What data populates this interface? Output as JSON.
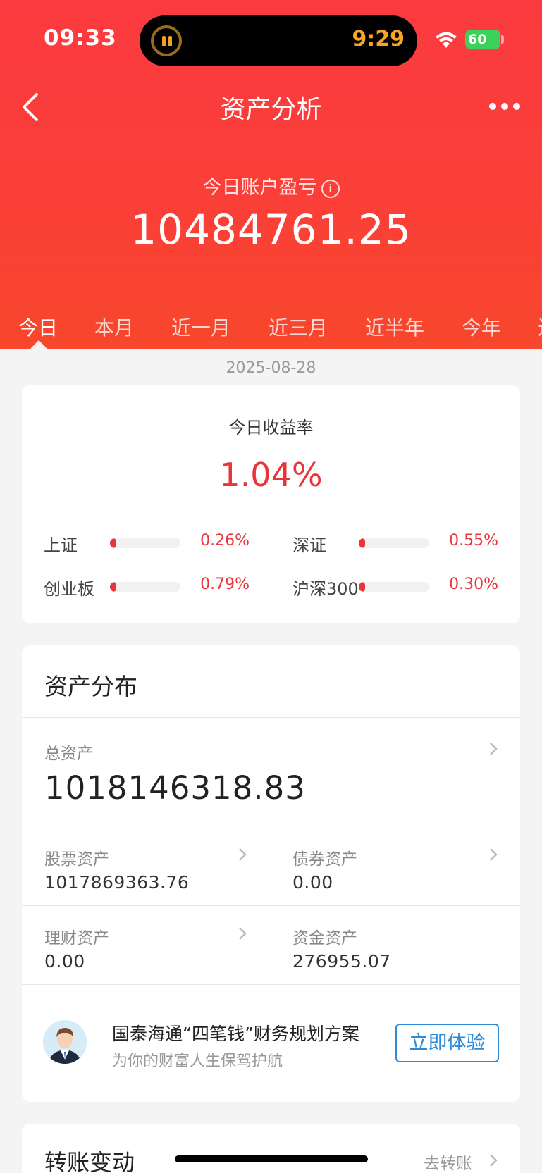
{
  "status_bar": {
    "time": "09:33",
    "island_time": "9:29",
    "battery": "60"
  },
  "nav": {
    "title": "资产分析"
  },
  "summary": {
    "label": "今日账户盈亏",
    "value": "10484761.25",
    "info_glyph": "i"
  },
  "tabs": [
    {
      "label": "今日",
      "active": true
    },
    {
      "label": "本月",
      "active": false
    },
    {
      "label": "近一月",
      "active": false
    },
    {
      "label": "近三月",
      "active": false
    },
    {
      "label": "近半年",
      "active": false
    },
    {
      "label": "今年",
      "active": false
    },
    {
      "label": "近",
      "active": false
    }
  ],
  "date": "2025-08-28",
  "returns": {
    "label": "今日收益率",
    "value": "1.04%",
    "indices": [
      {
        "name": "上证",
        "value": "0.26%",
        "fill_percent": 0.26
      },
      {
        "name": "深证",
        "value": "0.55%",
        "fill_percent": 0.55
      },
      {
        "name": "创业板",
        "value": "0.79%",
        "fill_percent": 0.79
      },
      {
        "name": "沪深300",
        "value": "0.30%",
        "fill_percent": 0.3
      }
    ]
  },
  "assets": {
    "title": "资产分布",
    "total": {
      "label": "总资产",
      "value": "1018146318.83"
    },
    "items": [
      {
        "label": "股票资产",
        "value": "1017869363.76"
      },
      {
        "label": "债券资产",
        "value": "0.00"
      },
      {
        "label": "理财资产",
        "value": "0.00"
      },
      {
        "label": "资金资产",
        "value": "276955.07"
      }
    ],
    "promo": {
      "title": "国泰海通“四笔钱”财务规划方案",
      "subtitle": "为你的财富人生保驾护航",
      "button": "立即体验"
    }
  },
  "transfer": {
    "title": "转账变动",
    "link": "去转账"
  },
  "colors": {
    "primary_red": "#fb3a3f",
    "gain_red": "#e8343a",
    "link_blue": "#2f8bd6"
  }
}
